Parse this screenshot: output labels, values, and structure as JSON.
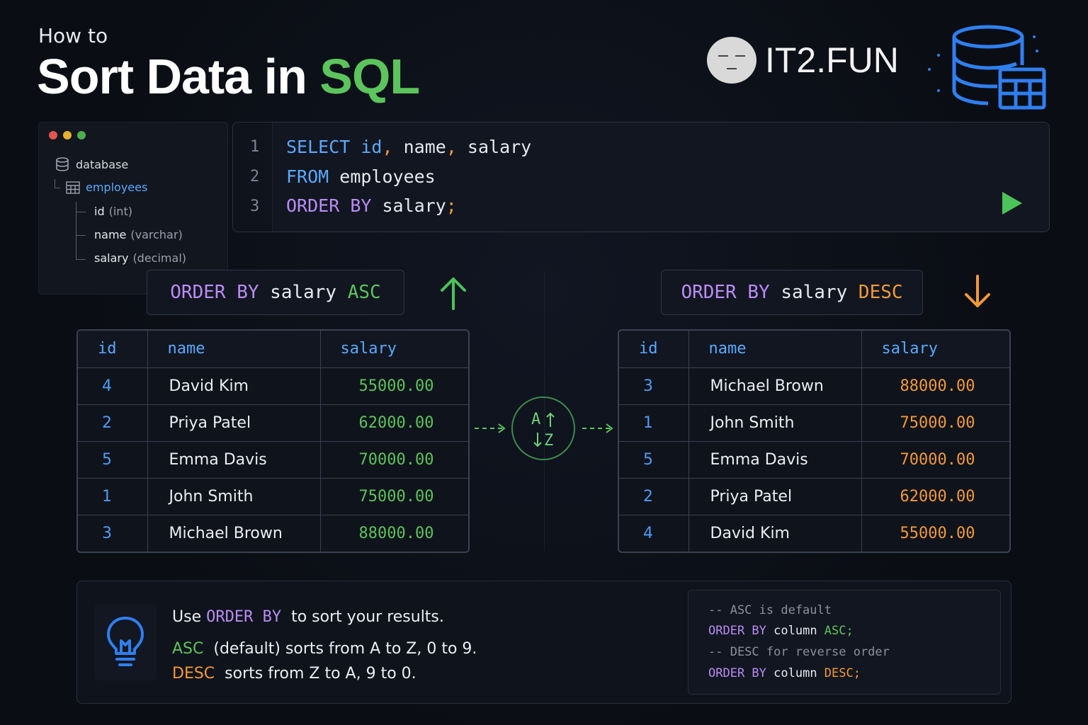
{
  "header": {
    "subtitle": "How to",
    "title_main": "Sort Data in ",
    "title_accent": "SQL",
    "brand": "IT2.FUN"
  },
  "colors": {
    "background": "#0b0e14",
    "keyword_blue": "#5aa9ff",
    "keyword_purple": "#b98cf5",
    "asc_green": "#5cc45c",
    "desc_orange": "#f29a3a"
  },
  "icons": [
    "database-icon",
    "table-icon",
    "play-icon",
    "arrow-up-icon",
    "arrow-down-icon",
    "sort-az-icon",
    "lightbulb-icon",
    "database-table-icon",
    "avatar-icon"
  ],
  "sidebar": {
    "database_label": "database",
    "table_label": "employees",
    "columns": [
      {
        "name": "id",
        "type": "(int)"
      },
      {
        "name": "name",
        "type": "(varchar)"
      },
      {
        "name": "salary",
        "type": "(decimal)"
      }
    ]
  },
  "editor": {
    "line_numbers": [
      "1",
      "2",
      "3"
    ],
    "line1": {
      "kw": "SELECT",
      "c1": "id",
      "sep1": ",",
      "c2": " name",
      "sep2": ",",
      "c3": " salary"
    },
    "line2": {
      "kw": "FROM",
      "rest": " employees"
    },
    "line3": {
      "kw1": "ORDER",
      "kw2": " BY",
      "rest": " salary",
      "semi": ";"
    }
  },
  "asc": {
    "order": "ORDER",
    "by": " BY",
    "col": " salary ",
    "dir": "ASC",
    "headers": [
      "id",
      "name",
      "salary"
    ],
    "rows": [
      [
        "4",
        "David Kim",
        "55000.00"
      ],
      [
        "2",
        "Priya Patel",
        "62000.00"
      ],
      [
        "5",
        "Emma Davis",
        "70000.00"
      ],
      [
        "1",
        "John Smith",
        "75000.00"
      ],
      [
        "3",
        "Michael Brown",
        "88000.00"
      ]
    ]
  },
  "desc": {
    "order": "ORDER",
    "by": " BY",
    "col": " salary ",
    "dir": "DESC",
    "headers": [
      "id",
      "name",
      "salary"
    ],
    "rows": [
      [
        "3",
        "Michael Brown",
        "88000.00"
      ],
      [
        "1",
        "John Smith",
        "75000.00"
      ],
      [
        "5",
        "Emma Davis",
        "70000.00"
      ],
      [
        "2",
        "Priya Patel",
        "62000.00"
      ],
      [
        "4",
        "David Kim",
        "55000.00"
      ]
    ]
  },
  "sort_badge": {
    "a": "A",
    "z": "Z"
  },
  "info": {
    "line1_pre": "Use ",
    "line1_kw1": "ORDER",
    "line1_kw2": " BY",
    "line1_post": "  to sort your results.",
    "line2_kw": "ASC",
    "line2_post": "  (default) sorts from A to Z, 0 to 9.",
    "line3_kw": "DESC",
    "line3_post": "  sorts from Z to A, 9 to 0."
  },
  "tips": {
    "c1": "-- ASC is default",
    "l2_kw1": "ORDER",
    "l2_kw2": " BY",
    "l2_col": " column ",
    "l2_dir": "ASC;",
    "c2": "-- DESC for reverse order",
    "l4_kw1": "ORDER",
    "l4_kw2": " BY",
    "l4_col": " column ",
    "l4_dir": "DESC;"
  }
}
